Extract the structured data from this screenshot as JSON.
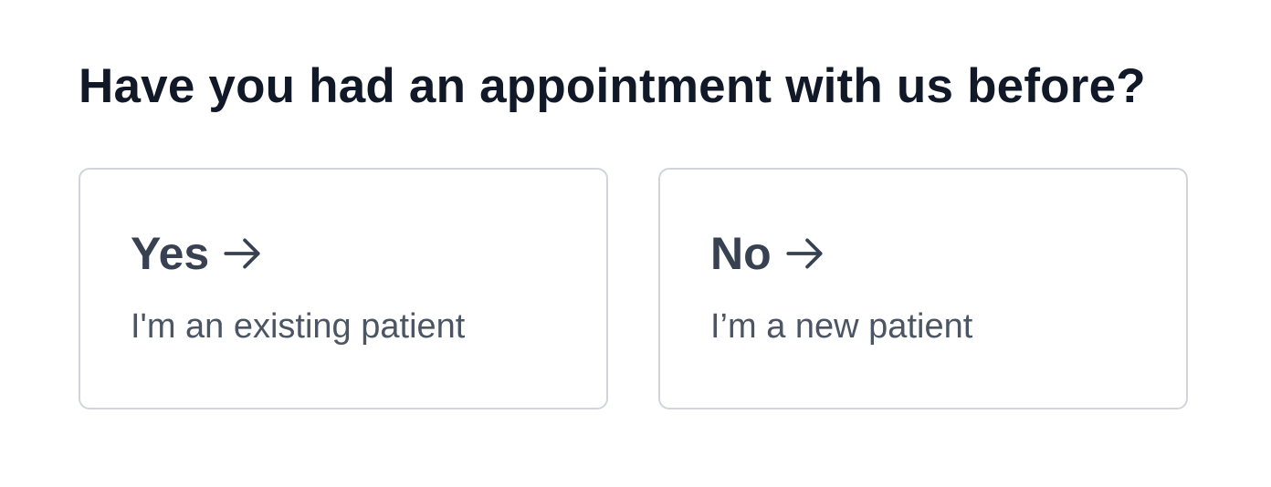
{
  "question": "Have you had an appointment with us before?",
  "options": [
    {
      "label": "Yes",
      "description": "I'm an existing patient",
      "icon": "arrow-right-icon"
    },
    {
      "label": "No",
      "description": "I’m a new patient",
      "icon": "arrow-right-icon"
    }
  ],
  "colors": {
    "heading": "#111827",
    "title": "#374151",
    "description": "#4b5563",
    "border": "#d1d5db"
  }
}
